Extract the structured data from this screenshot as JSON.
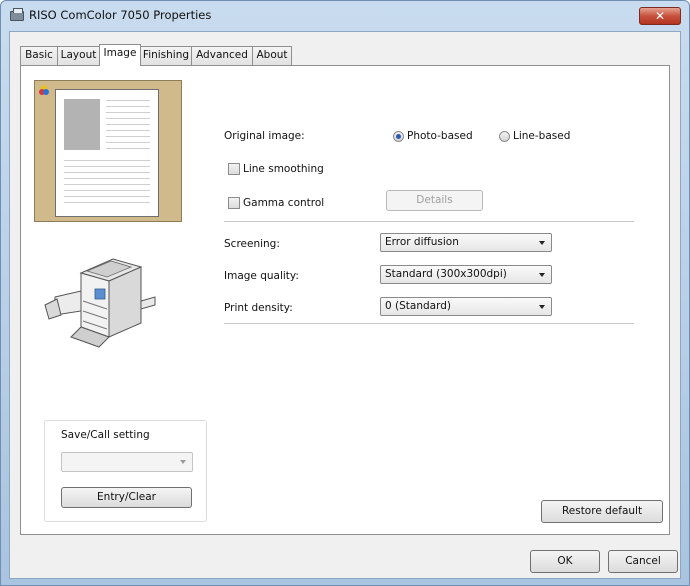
{
  "window": {
    "title": "RISO ComColor 7050 Properties",
    "close_glyph": "✕",
    "app_icon": "printer-icon"
  },
  "tabs": [
    {
      "label": "Basic",
      "active": false
    },
    {
      "label": "Layout",
      "active": false
    },
    {
      "label": "Image",
      "active": true
    },
    {
      "label": "Finishing",
      "active": false
    },
    {
      "label": "Advanced",
      "active": false
    },
    {
      "label": "About",
      "active": false
    }
  ],
  "preview": {
    "color_mode_icon": "color-dots-icon",
    "colors": {
      "frame": "#d0b98b",
      "photo": "#b3b3b3"
    }
  },
  "image_settings": {
    "original_image_label": "Original image:",
    "photo_based_label": "Photo-based",
    "line_based_label": "Line-based",
    "selected_original": "Photo-based",
    "line_smoothing_label": "Line smoothing",
    "line_smoothing_checked": false,
    "gamma_control_label": "Gamma control",
    "gamma_control_checked": false,
    "details_label": "Details",
    "screening_label": "Screening:",
    "screening_value": "Error diffusion",
    "image_quality_label": "Image quality:",
    "image_quality_value": "Standard (300x300dpi)",
    "print_density_label": "Print density:",
    "print_density_value": "0 (Standard)"
  },
  "save_call": {
    "group_label": "Save/Call setting",
    "selected_value": "",
    "entry_clear_label": "Entry/Clear"
  },
  "buttons": {
    "restore_default": "Restore default",
    "ok": "OK",
    "cancel": "Cancel"
  },
  "colors": {
    "accent": "#2a5db6",
    "close_button": "#c7523d"
  }
}
